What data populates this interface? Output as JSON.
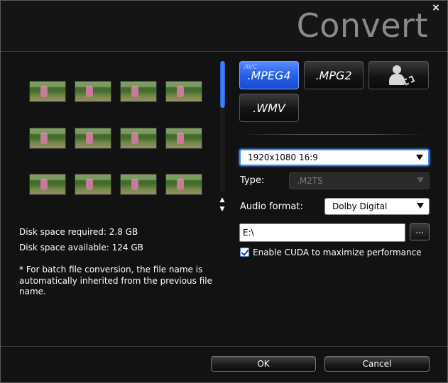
{
  "window": {
    "title": "Convert",
    "close_symbol": "×"
  },
  "thumbnails": [
    {
      "label": ""
    },
    {
      "label": ""
    },
    {
      "label": ""
    },
    {
      "label": ""
    },
    {
      "label": ""
    },
    {
      "label": ""
    },
    {
      "label": ""
    },
    {
      "label": ""
    },
    {
      "label": ""
    },
    {
      "label": ""
    },
    {
      "label": ""
    },
    {
      "label": ""
    }
  ],
  "disk": {
    "required": "Disk space required: 2.8 GB",
    "available": "Disk space available: 124 GB"
  },
  "note": "* For batch file conversion, the file name is automatically inherited from the previous file name.",
  "formats": {
    "mpeg4": {
      "label": ".MPEG4",
      "tag": "AVC"
    },
    "mpg2": {
      "label": ".MPG2"
    },
    "wmv": {
      "label": ".WMV"
    },
    "profile_icon": "person-video-icon"
  },
  "settings": {
    "resolution": "1920x1080 16:9",
    "type_label": "Type:",
    "type_value": ".M2TS",
    "audio_label": "Audio format:",
    "audio_value": "Dolby Digital",
    "path_value": "E:\\",
    "browse_label": "...",
    "cuda_label": "Enable CUDA to maximize performance",
    "cuda_checked": true
  },
  "buttons": {
    "ok": "OK",
    "cancel": "Cancel"
  },
  "colors": {
    "accent": "#2460e8",
    "background": "#121212"
  }
}
